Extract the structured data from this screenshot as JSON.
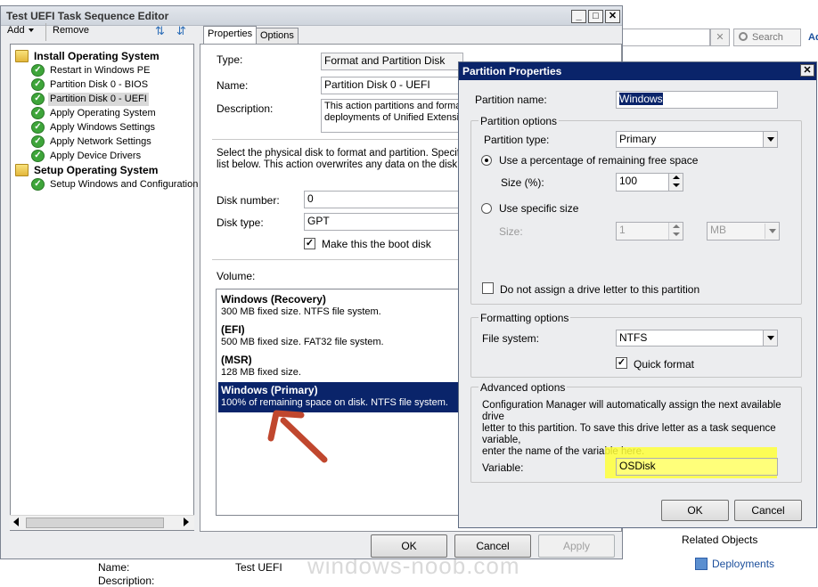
{
  "background": {
    "search_label": "Search",
    "ad_fragment": "Ad",
    "related_objects": "Related Objects",
    "deployments": "Deployments",
    "name_label": "Name:",
    "name_value": "Test UEFI",
    "description_label": "Description:",
    "watermark": "windows-noob.com"
  },
  "editor": {
    "title": "Test UEFI Task Sequence Editor",
    "toolbar": {
      "add": "Add",
      "remove": "Remove"
    },
    "tree": [
      {
        "label": "Install Operating System",
        "group": true,
        "selected": false
      },
      {
        "label": "Restart in Windows PE",
        "group": false,
        "selected": false
      },
      {
        "label": "Partition Disk 0 - BIOS",
        "group": false,
        "selected": false
      },
      {
        "label": "Partition Disk 0 - UEFI",
        "group": false,
        "selected": true
      },
      {
        "label": "Apply Operating System",
        "group": false,
        "selected": false
      },
      {
        "label": "Apply Windows Settings",
        "group": false,
        "selected": false
      },
      {
        "label": "Apply Network Settings",
        "group": false,
        "selected": false
      },
      {
        "label": "Apply Device Drivers",
        "group": false,
        "selected": false
      },
      {
        "label": "Setup Operating System",
        "group": true,
        "selected": false
      },
      {
        "label": "Setup Windows and Configuration",
        "group": false,
        "selected": false
      }
    ],
    "tabs": {
      "properties": "Properties",
      "options": "Options"
    },
    "props": {
      "type_label": "Type:",
      "type_value": "Format and Partition Disk",
      "name_label": "Name:",
      "name_value": "Partition Disk 0 - UEFI",
      "description_label": "Description:",
      "description_line1": "This action partitions and format",
      "description_line2": "deployments of Unified Extensib",
      "info_line1": "Select the physical disk to format and partition. Specify the",
      "info_line2": "list below. This action overwrites any data on the disk.",
      "disk_number_label": "Disk number:",
      "disk_number_value": "0",
      "disk_type_label": "Disk type:",
      "disk_type_value": "GPT",
      "boot_disk_label": "Make this the boot disk",
      "volume_label": "Volume:"
    },
    "volumes": [
      {
        "title": "Windows (Recovery)",
        "detail": "300 MB fixed size. NTFS file system.",
        "selected": false
      },
      {
        "title": "(EFI)",
        "detail": "500 MB fixed size. FAT32 file system.",
        "selected": false
      },
      {
        "title": "(MSR)",
        "detail": "128 MB fixed size.",
        "selected": false
      },
      {
        "title": "Windows (Primary)",
        "detail": "100% of remaining space on disk. NTFS file system.",
        "selected": true
      }
    ],
    "buttons": {
      "ok": "OK",
      "cancel": "Cancel",
      "apply": "Apply"
    }
  },
  "dialog": {
    "title": "Partition Properties",
    "partition_name_label": "Partition name:",
    "partition_name_value": "Windows",
    "partition_options_title": "Partition options",
    "partition_type_label": "Partition type:",
    "partition_type_value": "Primary",
    "use_percentage_label": "Use a percentage of remaining free space",
    "size_pct_label": "Size (%):",
    "size_pct_value": "100",
    "use_specific_label": "Use specific size",
    "size_label": "Size:",
    "size_value": "1",
    "size_unit": "MB",
    "no_drive_letter_label": "Do not assign a drive letter to this partition",
    "formatting_title": "Formatting options",
    "file_system_label": "File system:",
    "file_system_value": "NTFS",
    "quick_format_label": "Quick format",
    "advanced_title": "Advanced options",
    "advanced_text_1": "Configuration Manager will automatically assign the next available drive",
    "advanced_text_2": "letter to this partition. To save this drive letter as a task sequence variable,",
    "advanced_text_3": "enter the name of the variable here.",
    "variable_label": "Variable:",
    "variable_value": "OSDisk",
    "ok": "OK",
    "cancel": "Cancel"
  },
  "colors": {
    "title_bar": "#0a246a",
    "highlight": "#ffff3a",
    "annotation_arrow": "#c0472e"
  }
}
